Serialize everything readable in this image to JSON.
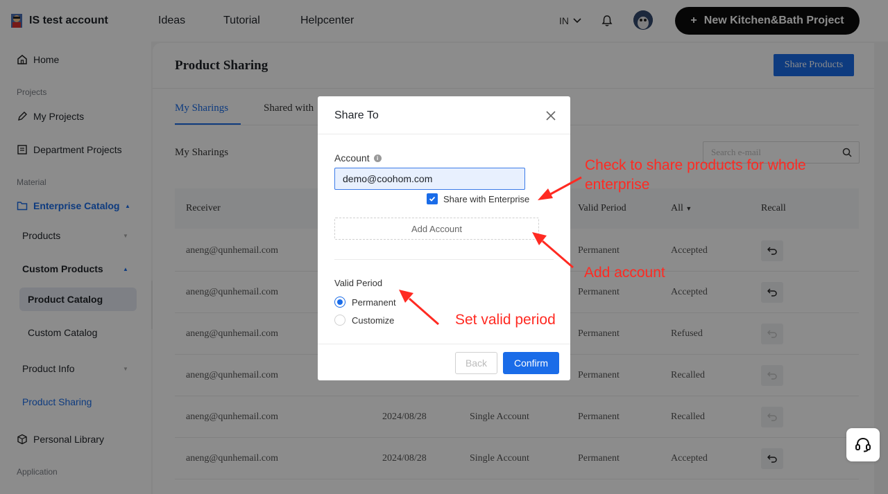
{
  "header": {
    "account_name": "IS test account",
    "nav": [
      "Ideas",
      "Tutorial",
      "Helpcenter"
    ],
    "lang": "IN",
    "new_project_label": "New Kitchen&Bath Project"
  },
  "sidebar": {
    "home": "Home",
    "section_projects": "Projects",
    "my_projects": "My Projects",
    "department_projects": "Department Projects",
    "section_material": "Material",
    "enterprise_catalog": "Enterprise Catalog",
    "products": "Products",
    "custom_products": "Custom Products",
    "product_catalog": "Product Catalog",
    "custom_catalog": "Custom Catalog",
    "product_info": "Product Info",
    "product_sharing": "Product Sharing",
    "personal_library": "Personal Library",
    "section_application": "Application"
  },
  "page": {
    "title": "Product Sharing",
    "share_button": "Share Products",
    "tabs": [
      "My Sharings",
      "Shared with"
    ],
    "sub_heading": "My Sharings",
    "search_placeholder": "Search e-mail"
  },
  "table": {
    "headers": {
      "receiver": "Receiver",
      "valid_period": "Valid Period",
      "status": "All",
      "recall": "Recall"
    },
    "rows": [
      {
        "receiver": "aneng@qunhemail.com",
        "date": "",
        "type": "",
        "period": "Permanent",
        "status": "Accepted",
        "recall_enabled": true
      },
      {
        "receiver": "aneng@qunhemail.com",
        "date": "",
        "type": "",
        "period": "Permanent",
        "status": "Accepted",
        "recall_enabled": true
      },
      {
        "receiver": "aneng@qunhemail.com",
        "date": "",
        "type": "",
        "period": "Permanent",
        "status": "Refused",
        "recall_enabled": false
      },
      {
        "receiver": "aneng@qunhemail.com",
        "date": "",
        "type": "",
        "period": "Permanent",
        "status": "Recalled",
        "recall_enabled": false
      },
      {
        "receiver": "aneng@qunhemail.com",
        "date": "2024/08/28",
        "type": "Single Account",
        "period": "Permanent",
        "status": "Recalled",
        "recall_enabled": false
      },
      {
        "receiver": "aneng@qunhemail.com",
        "date": "2024/08/28",
        "type": "Single Account",
        "period": "Permanent",
        "status": "Accepted",
        "recall_enabled": true
      }
    ]
  },
  "modal": {
    "title": "Share To",
    "account_label": "Account",
    "account_value": "demo@coohom.com",
    "share_enterprise_label": "Share with Enterprise",
    "share_enterprise_checked": true,
    "add_account_label": "Add Account",
    "valid_period_label": "Valid Period",
    "options": [
      "Permanent",
      "Customize"
    ],
    "selected_option": "Permanent",
    "back_label": "Back",
    "confirm_label": "Confirm"
  },
  "annotations": {
    "enterprise_line1": "Check to share products for whole",
    "enterprise_line2": "enterprise",
    "add_account": "Add account",
    "valid_period": "Set valid period"
  },
  "colors": {
    "accent": "#1a6ce8",
    "annotation": "#ff2a22",
    "dark_button": "#0b0b0b"
  }
}
